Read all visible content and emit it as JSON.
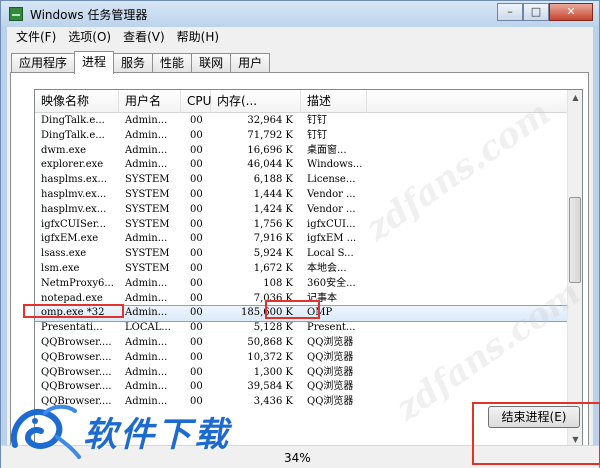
{
  "window": {
    "title": "Windows 任务管理器",
    "minimize": "–",
    "maximize": "□",
    "close": "✕"
  },
  "menu": [
    "文件(F)",
    "选项(O)",
    "查看(V)",
    "帮助(H)"
  ],
  "tabs": [
    "应用程序",
    "进程",
    "服务",
    "性能",
    "联网",
    "用户"
  ],
  "columns": [
    "映像名称",
    "用户名",
    "CPU",
    "内存(...",
    "描述"
  ],
  "rows": [
    [
      "DingTalk.e...",
      "Admin...",
      "00",
      "32,964 K",
      "钉钉"
    ],
    [
      "DingTalk.e...",
      "Admin...",
      "00",
      "71,792 K",
      "钉钉"
    ],
    [
      "dwm.exe",
      "Admin...",
      "00",
      "16,696 K",
      "桌面窗..."
    ],
    [
      "explorer.exe",
      "Admin...",
      "00",
      "46,044 K",
      "Windows..."
    ],
    [
      "hasplms.ex...",
      "SYSTEM",
      "00",
      "6,188 K",
      "License..."
    ],
    [
      "hasplmv.ex...",
      "SYSTEM",
      "00",
      "1,444 K",
      "Vendor ..."
    ],
    [
      "hasplmv.ex...",
      "SYSTEM",
      "00",
      "1,424 K",
      "Vendor ..."
    ],
    [
      "igfxCUISer...",
      "SYSTEM",
      "00",
      "1,756 K",
      "igfxCUI..."
    ],
    [
      "igfxEM.exe",
      "Admin...",
      "00",
      "7,916 K",
      "igfxEM ..."
    ],
    [
      "lsass.exe",
      "SYSTEM",
      "00",
      "5,924 K",
      "Local S..."
    ],
    [
      "lsm.exe",
      "SYSTEM",
      "00",
      "1,672 K",
      "本地会..."
    ],
    [
      "NetmProxy6...",
      "Admin...",
      "00",
      "108 K",
      "360安全..."
    ],
    [
      "notepad.exe",
      "Admin...",
      "00",
      "7,036 K",
      "记事本"
    ],
    [
      "omp.exe *32",
      "Admin...",
      "00",
      "185,600 K",
      "OMP"
    ],
    [
      "Presentati...",
      "LOCAL...",
      "00",
      "5,128 K",
      "Present..."
    ],
    [
      "QQBrowser....",
      "Admin...",
      "00",
      "50,868 K",
      "QQ浏览器"
    ],
    [
      "QQBrowser....",
      "Admin...",
      "00",
      "10,372 K",
      "QQ浏览器"
    ],
    [
      "QQBrowser....",
      "Admin...",
      "00",
      "1,300 K",
      "QQ浏览器"
    ],
    [
      "QQBrowser....",
      "Admin...",
      "00",
      "39,584 K",
      "QQ浏览器"
    ],
    [
      "QQBrowser....",
      "Admin...",
      "00",
      "3,436 K",
      "QQ浏览器"
    ]
  ],
  "selected_row": 13,
  "end_process_button": "结束进程(E)",
  "status": {
    "cpu": "34%"
  },
  "logo": {
    "text": "软件下载"
  },
  "watermark": "zdfans.com",
  "colors": {
    "highlight": "#e0332b",
    "logo_blue": "#1d6bd0"
  }
}
